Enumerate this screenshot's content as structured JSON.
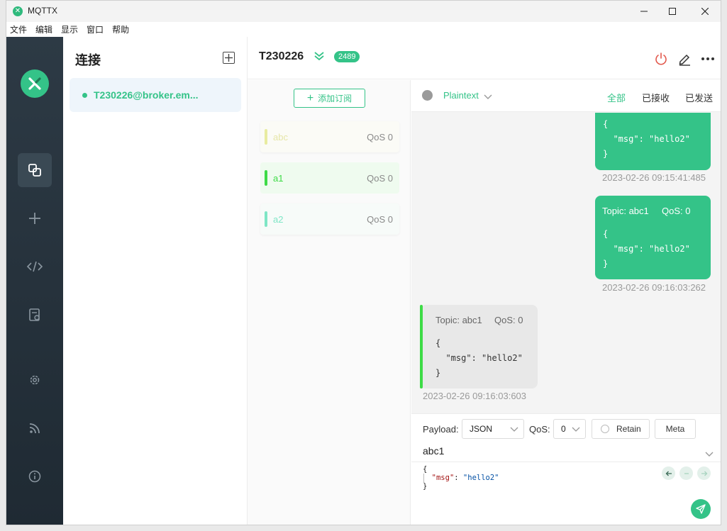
{
  "window": {
    "title": "MQTTX"
  },
  "menu": [
    "文件",
    "编辑",
    "显示",
    "窗口",
    "帮助"
  ],
  "sidebar": {
    "items": [
      {
        "name": "connections",
        "icon": "connections-icon",
        "active": true
      },
      {
        "name": "new",
        "icon": "plus-icon",
        "active": false
      },
      {
        "name": "script",
        "icon": "code-icon",
        "active": false
      },
      {
        "name": "log",
        "icon": "log-icon",
        "active": false
      },
      {
        "name": "settings",
        "icon": "gear-icon",
        "active": false
      },
      {
        "name": "subscribe",
        "icon": "rss-icon",
        "active": false
      },
      {
        "name": "about",
        "icon": "info-icon",
        "active": false
      }
    ]
  },
  "connections": {
    "title": "连接",
    "items": [
      {
        "name": "T230226@broker.em...",
        "status": "connected"
      }
    ]
  },
  "header": {
    "title": "T230226",
    "badge": "2489"
  },
  "subscriptions": {
    "add_label": "添加订阅",
    "items": [
      {
        "topic": "abc",
        "qos": "QoS 0",
        "color": "#e8eca0"
      },
      {
        "topic": "a1",
        "qos": "QoS 0",
        "color": "#3ddb46"
      },
      {
        "topic": "a2",
        "qos": "QoS 0",
        "color": "#7ee6c6"
      }
    ]
  },
  "filter": {
    "format": "Plaintext",
    "tabs": [
      "全部",
      "已接收",
      "已发送"
    ],
    "active_tab": "全部"
  },
  "messages": [
    {
      "direction": "out",
      "topic": "",
      "qos": "",
      "payload": "{\n  \"msg\": \"hello2\"\n}",
      "time": "2023-02-26 09:15:41:485"
    },
    {
      "direction": "out",
      "topic": "Topic: abc1",
      "qos": "QoS: 0",
      "payload": "{\n  \"msg\": \"hello2\"\n}",
      "time": "2023-02-26 09:16:03:262"
    },
    {
      "direction": "in",
      "topic": "Topic: abc1",
      "qos": "QoS: 0",
      "payload": "{\n  \"msg\": \"hello2\"\n}",
      "time": "2023-02-26 09:16:03:603"
    }
  ],
  "composer": {
    "payload_label": "Payload:",
    "payload_format": "JSON",
    "qos_label": "QoS:",
    "qos_value": "0",
    "retain_label": "Retain",
    "meta_label": "Meta",
    "topic": "abc1",
    "editor_open": "{",
    "editor_key": "\"msg\"",
    "editor_colon": ": ",
    "editor_value": "\"hello2\"",
    "editor_close": "}"
  },
  "colors": {
    "accent": "#34c388",
    "sidebar_bg": "#2d3a45",
    "incoming_bar": "#3ddb46"
  }
}
